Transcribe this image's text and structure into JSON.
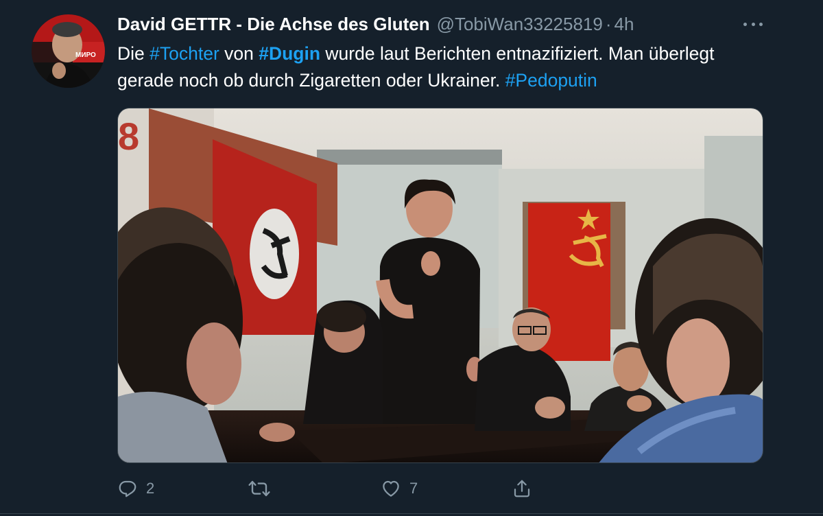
{
  "author": {
    "name": "David GETTR - Die Achse des Gluten",
    "handle": "@TobiWan33225819",
    "separator": "·",
    "time": "4h",
    "avatar_caption": "МИРО"
  },
  "tweet": {
    "segments": [
      {
        "text": "Die ",
        "type": "plain"
      },
      {
        "text": "#Tochter",
        "type": "hashtag"
      },
      {
        "text": " von ",
        "type": "plain"
      },
      {
        "text": "#Dugin",
        "type": "hashtag-bold"
      },
      {
        "text": " wurde laut Berichten entnazifiziert. Man überlegt gerade noch ob durch Zigaretten oder Ukrainer. ",
        "type": "plain"
      },
      {
        "text": "#Pedoputin",
        "type": "hashtag"
      }
    ]
  },
  "media": {
    "wall_numeral": "8"
  },
  "actions": {
    "reply_count": "2",
    "retweet_count": "",
    "like_count": "7"
  },
  "icons": {
    "reply": "reply-icon",
    "retweet": "retweet-icon",
    "like": "heart-icon",
    "share": "share-icon",
    "more": "more-icon"
  },
  "colors": {
    "background": "#15202b",
    "accent": "#1da1f2",
    "secondary_text": "#8899a6"
  }
}
